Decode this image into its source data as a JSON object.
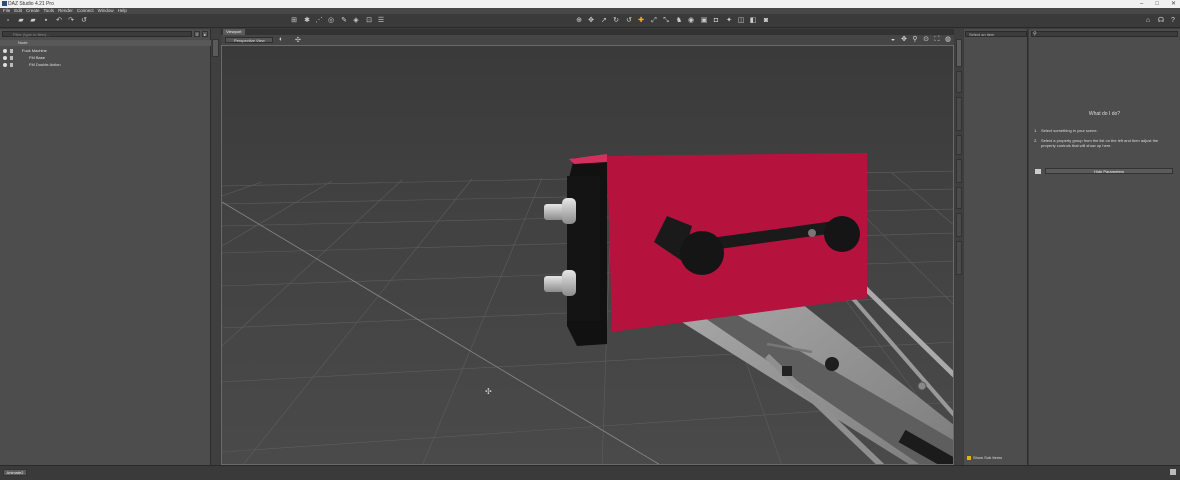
{
  "window": {
    "title": "DAZ Studio 4.21 Pro",
    "min": "–",
    "max": "□",
    "close": "✕"
  },
  "menu": [
    "File",
    "Edit",
    "Create",
    "Tools",
    "Render",
    "Connect",
    "Window",
    "Help"
  ],
  "scene": {
    "search_placeholder": "Filter (type to filter)...",
    "header": "Node",
    "items": [
      {
        "label": "Fuck Machine",
        "depth": 0
      },
      {
        "label": "FM Base",
        "depth": 1
      },
      {
        "label": "FM Double Action",
        "depth": 1
      }
    ]
  },
  "viewport": {
    "tab": "Viewport",
    "camera": "Perspective View"
  },
  "parameters": {
    "group_select": "Select an item",
    "search_placeholder": "",
    "help_title": "What do I do?",
    "step1": "Select something in your scene.",
    "step2": "Select a property group from the list on the left and then adjust the property controls that will show up here.",
    "step1_num": "1.",
    "step2_num": "2.",
    "hide_button": "Hide Parameters",
    "show_sub": "Show Sub Items"
  },
  "status": {
    "tab": "Animate2"
  },
  "colors": {
    "box": "#b5133e",
    "grid": "#5a5a5a",
    "floor": "#4a4a4a"
  }
}
